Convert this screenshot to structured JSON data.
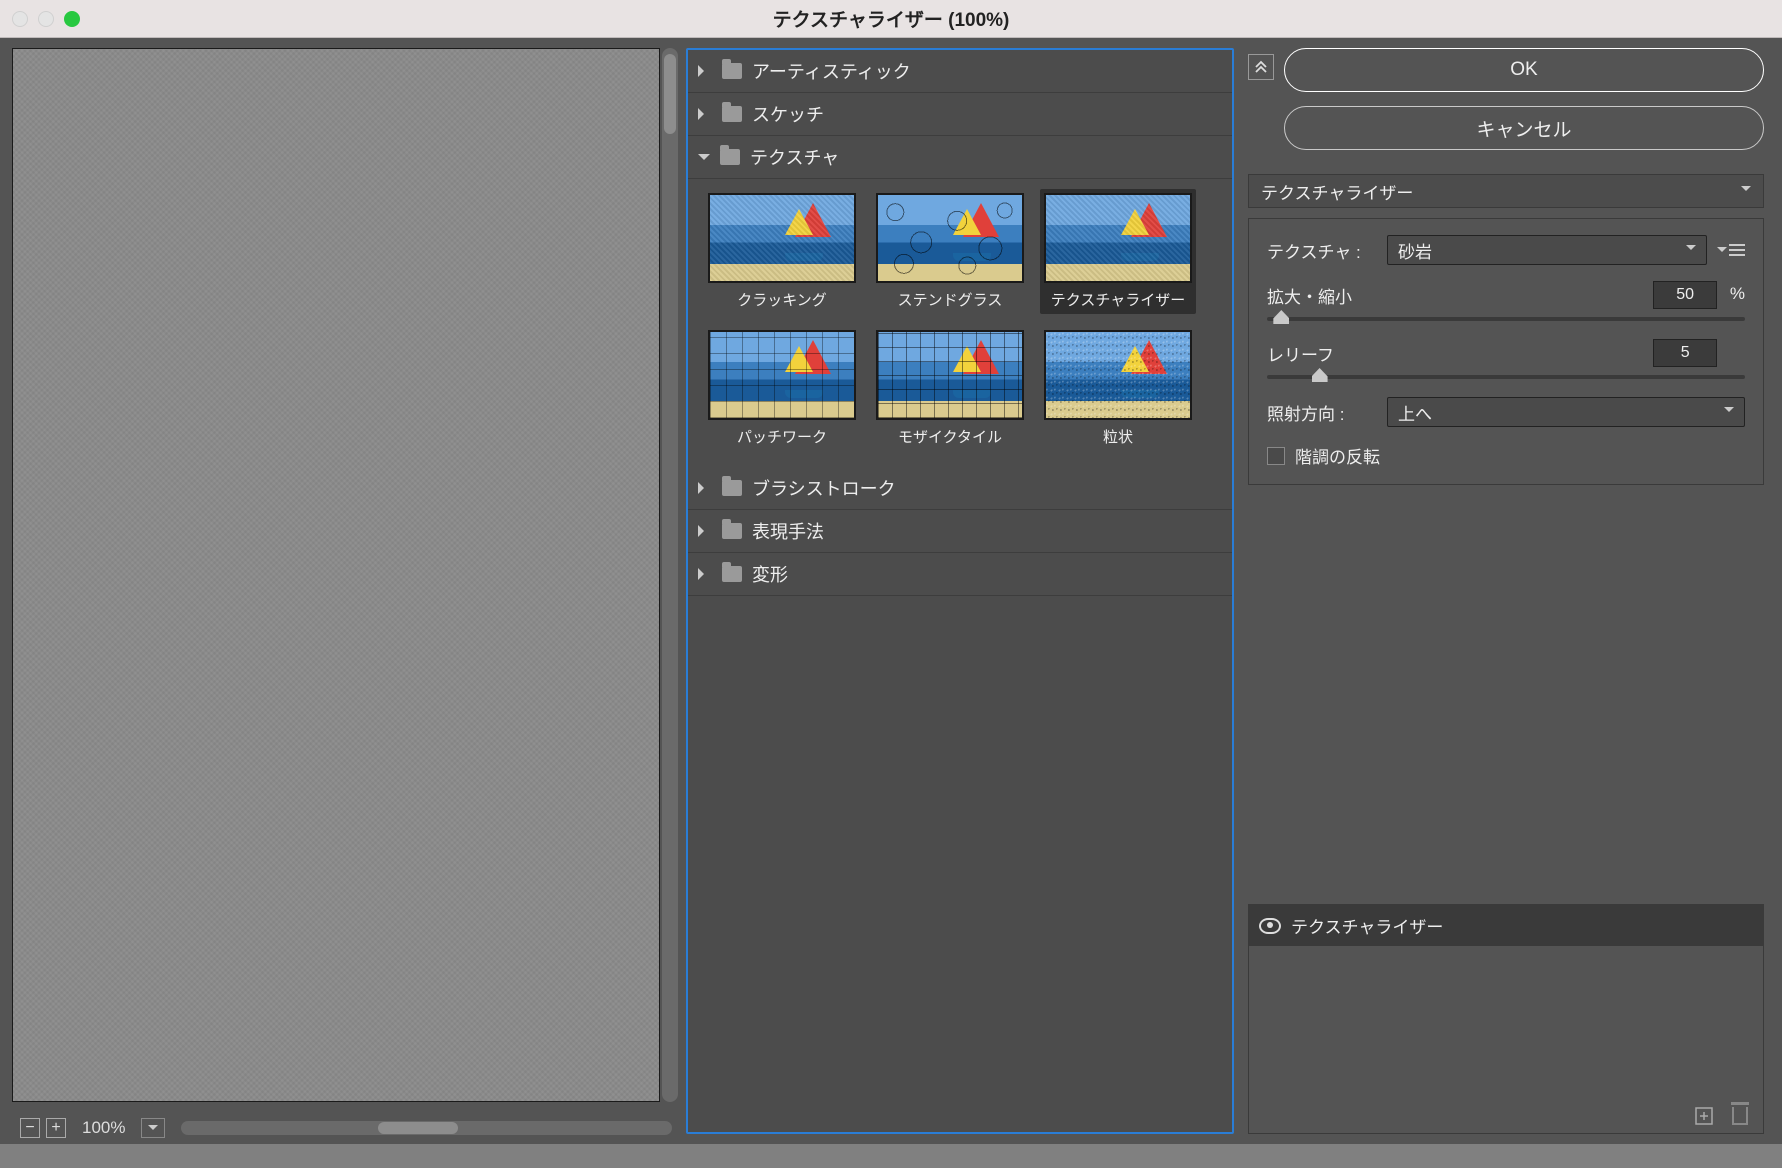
{
  "window": {
    "title": "テクスチャライザー (100%)"
  },
  "zoom": {
    "value": "100%"
  },
  "categories": [
    {
      "label": "アーティスティック",
      "open": false
    },
    {
      "label": "スケッチ",
      "open": false
    },
    {
      "label": "テクスチャ",
      "open": true
    },
    {
      "label": "ブラシストローク",
      "open": false
    },
    {
      "label": "表現手法",
      "open": false
    },
    {
      "label": "変形",
      "open": false
    }
  ],
  "thumbs": [
    {
      "label": "クラッキング"
    },
    {
      "label": "ステンドグラス"
    },
    {
      "label": "テクスチャライザー"
    },
    {
      "label": "パッチワーク"
    },
    {
      "label": "モザイクタイル"
    },
    {
      "label": "粒状"
    }
  ],
  "buttons": {
    "ok": "OK",
    "cancel": "キャンセル"
  },
  "filter_dd": "テクスチャライザー",
  "params": {
    "texture_label": "テクスチャ :",
    "texture_value": "砂岩",
    "scale_label": "拡大・縮小",
    "scale_value": "50",
    "scale_unit": "%",
    "relief_label": "レリーフ",
    "relief_value": "5",
    "light_label": "照射方向 :",
    "light_value": "上へ",
    "invert_label": "階調の反転"
  },
  "layers": {
    "item0": "テクスチャライザー"
  }
}
